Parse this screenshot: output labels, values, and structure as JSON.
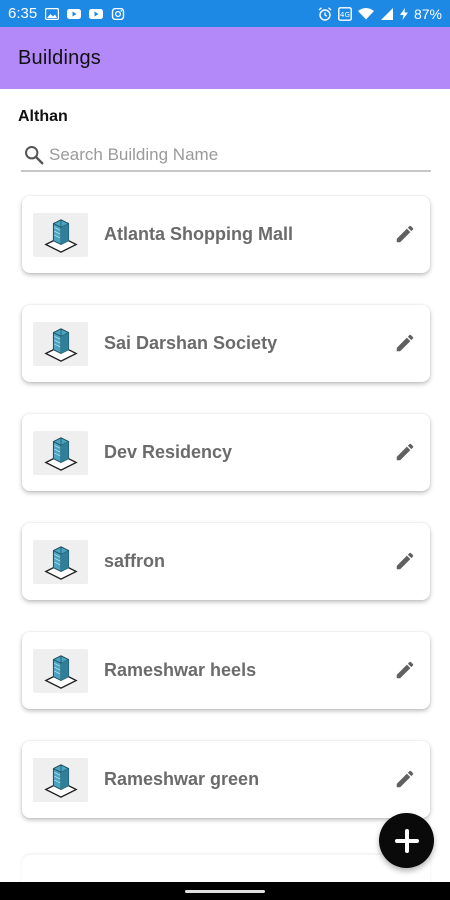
{
  "status_bar": {
    "time": "6:35",
    "battery": "87%",
    "background_color": "#1e88e5"
  },
  "app_bar": {
    "title": "Buildings",
    "background_color": "#b388f9"
  },
  "section": {
    "label": "Althan"
  },
  "search": {
    "placeholder": "Search Building Name",
    "value": ""
  },
  "buildings": [
    {
      "name": "Atlanta Shopping Mall"
    },
    {
      "name": "Sai Darshan Society"
    },
    {
      "name": "Dev Residency"
    },
    {
      "name": "saffron"
    },
    {
      "name": "Rameshwar heels"
    },
    {
      "name": "Rameshwar green"
    }
  ],
  "icons": {
    "search": "search-icon",
    "edit": "edit-icon",
    "building": "building-icon",
    "fab": "plus-icon"
  },
  "colors": {
    "card_text": "#6b6b6b",
    "fab": "#0a0a0a"
  }
}
